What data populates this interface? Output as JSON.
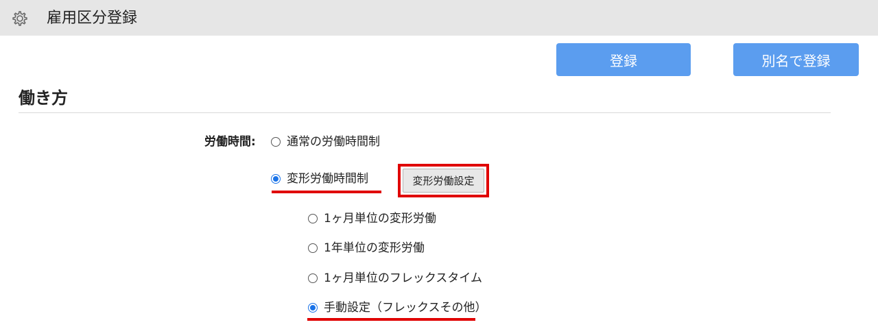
{
  "header": {
    "icon": "gear-icon",
    "title": "雇用区分登録"
  },
  "actions": {
    "register_label": "登録",
    "register_as_label": "別名で登録",
    "primary_color": "#5b9def"
  },
  "section": {
    "title": "働き方"
  },
  "work_hours": {
    "label": "労働時間:",
    "options": [
      {
        "label": "通常の労働時間制",
        "selected": false
      },
      {
        "label": "変形労働時間制",
        "selected": true
      }
    ],
    "settings_button_label": "変形労働設定",
    "sub_options": [
      {
        "label": "1ヶ月単位の変形労働",
        "selected": false
      },
      {
        "label": "1年単位の変形労働",
        "selected": false
      },
      {
        "label": "1ヶ月単位のフレックスタイム",
        "selected": false
      },
      {
        "label": "手動設定（フレックスその他）",
        "selected": true
      }
    ]
  },
  "annotation_color": "#e00000"
}
